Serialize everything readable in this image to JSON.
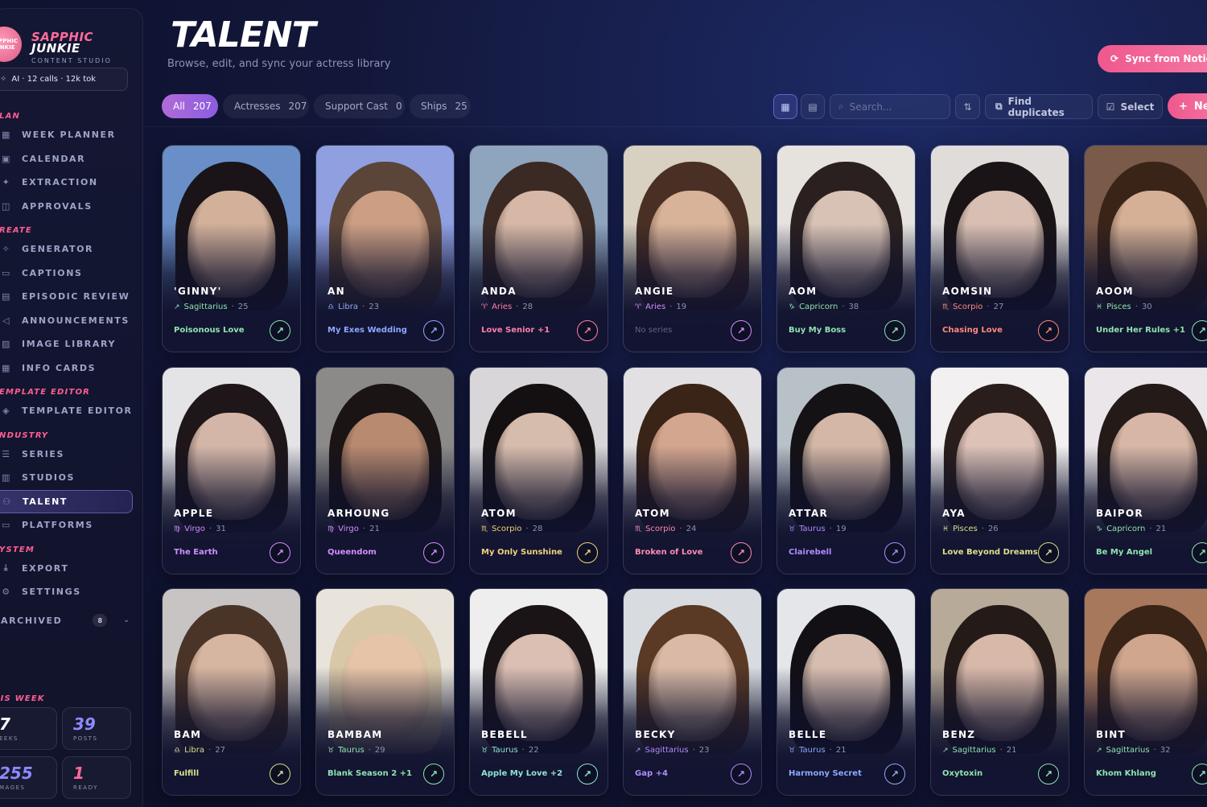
{
  "brand": {
    "logo_text": "SAPPHIC JUNKIE",
    "name_line1": "SAPPHIC",
    "name_line2": "JUNKIE",
    "subtitle": "CONTENT STUDIO",
    "ai_status": "AI · 12 calls · 12k tok"
  },
  "nav": {
    "sections": [
      {
        "title": "LAN",
        "items": [
          {
            "label": "WEEK PLANNER",
            "icon": "calendar-week-icon"
          },
          {
            "label": "CALENDAR",
            "icon": "calendar-icon"
          },
          {
            "label": "EXTRACTION",
            "icon": "magic-icon"
          },
          {
            "label": "APPROVALS",
            "icon": "inbox-icon"
          }
        ]
      },
      {
        "title": "REATE",
        "items": [
          {
            "label": "GENERATOR",
            "icon": "sparkle-icon"
          },
          {
            "label": "CAPTIONS",
            "icon": "caption-icon"
          },
          {
            "label": "EPISODIC REVIEW",
            "icon": "film-icon"
          },
          {
            "label": "ANNOUNCEMENTS",
            "icon": "megaphone-icon"
          },
          {
            "label": "IMAGE LIBRARY",
            "icon": "image-icon"
          },
          {
            "label": "INFO CARDS",
            "icon": "grid-icon"
          }
        ]
      },
      {
        "title": "EMPLATE EDITOR",
        "items": [
          {
            "label": "TEMPLATE EDITOR",
            "icon": "layers-icon"
          }
        ]
      },
      {
        "title": "NDUSTRY",
        "items": [
          {
            "label": "SERIES",
            "icon": "list-icon"
          },
          {
            "label": "STUDIOS",
            "icon": "building-icon"
          },
          {
            "label": "TALENT",
            "icon": "users-icon",
            "active": true
          },
          {
            "label": "PLATFORMS",
            "icon": "screen-icon"
          }
        ]
      },
      {
        "title": "YSTEM",
        "items": [
          {
            "label": "EXPORT",
            "icon": "download-icon"
          },
          {
            "label": "SETTINGS",
            "icon": "gear-icon"
          }
        ]
      }
    ],
    "archived": {
      "label": "ARCHIVED",
      "count": "8"
    }
  },
  "week": {
    "title": "HIS WEEK",
    "stats": [
      {
        "value": "7",
        "label": "EEKS",
        "color": "white"
      },
      {
        "value": "39",
        "label": "POSTS",
        "color": "purple"
      },
      {
        "value": "255",
        "label": "MAGES",
        "color": "purple"
      },
      {
        "value": "1",
        "label": "READY",
        "color": "pink"
      }
    ]
  },
  "header": {
    "title": "TALENT",
    "subtitle": "Browse, edit, and sync your actress library",
    "sync_label": "Sync from Notion"
  },
  "filters": [
    {
      "label": "All",
      "count": "207",
      "active": true
    },
    {
      "label": "Actresses",
      "count": "207"
    },
    {
      "label": "Support Cast",
      "count": "0"
    },
    {
      "label": "Ships",
      "count": "25"
    }
  ],
  "toolbar": {
    "search_placeholder": "Search...",
    "find_duplicates": "Find duplicates",
    "select": "Select",
    "new_label": "Ne"
  },
  "accent": {
    "pink": "#f0588d",
    "purple": "#8b5ce0"
  },
  "cards": [
    {
      "name": "'GINNY'",
      "sign": "Sagittarius",
      "sign_icon": "↗",
      "age": "25",
      "series": "Poisonous Love",
      "color": "#8fe3b0",
      "skin": "#e6c1a8",
      "hair": "#1a1418",
      "bg": "#6a8ec8"
    },
    {
      "name": "AN",
      "sign": "Libra",
      "sign_icon": "♎",
      "age": "23",
      "series": "My Exes Wedding",
      "color": "#8ea8ff",
      "skin": "#d9a98c",
      "hair": "#5a4538",
      "bg": "#8f9fe0"
    },
    {
      "name": "ANDA",
      "sign": "Aries",
      "sign_icon": "♈",
      "age": "28",
      "series": "Love Senior +1",
      "color": "#ff7fae",
      "skin": "#e8c7b4",
      "hair": "#3b2a24",
      "bg": "#8fa4bd"
    },
    {
      "name": "ANGIE",
      "sign": "Aries",
      "sign_icon": "♈",
      "age": "19",
      "series": "No series",
      "color": "#d48cff",
      "skin": "#e8c0a6",
      "hair": "#4a3024",
      "bg": "#d8d0c0",
      "none": true
    },
    {
      "name": "AOM",
      "sign": "Capricorn",
      "sign_icon": "♑",
      "age": "38",
      "series": "Buy My Boss",
      "color": "#8fe3b0",
      "skin": "#ecd4c6",
      "hair": "#2a2020",
      "bg": "#e6e2de"
    },
    {
      "name": "AOMSIN",
      "sign": "Scorpio",
      "sign_icon": "♏",
      "age": "27",
      "series": "Chasing Love",
      "color": "#ff8a7a",
      "skin": "#eed2c4",
      "hair": "#1a1416",
      "bg": "#e0dcda"
    },
    {
      "name": "AOOM",
      "sign": "Pisces",
      "sign_icon": "♓",
      "age": "30",
      "series": "Under Her Rules +1",
      "color": "#8fe3b0",
      "skin": "#e6c0a4",
      "hair": "#3a2418",
      "bg": "#7a5a48"
    },
    {
      "name": "APPLE",
      "sign": "Virgo",
      "sign_icon": "♍",
      "age": "31",
      "series": "The Earth",
      "color": "#d48cff",
      "skin": "#e8c8b8",
      "hair": "#1e1618",
      "bg": "#e4e4e6"
    },
    {
      "name": "ARHOUNG",
      "sign": "Virgo",
      "sign_icon": "♍",
      "age": "21",
      "series": "Queendom",
      "color": "#d48cff",
      "skin": "#c9977a",
      "hair": "#1a1414",
      "bg": "#8c8a88"
    },
    {
      "name": "ATOM",
      "sign": "Scorpio",
      "sign_icon": "♏",
      "age": "28",
      "series": "My Only Sunshine",
      "color": "#f0d27a",
      "skin": "#eccfbe",
      "hair": "#141012",
      "bg": "#d8d6d8"
    },
    {
      "name": "ATOM",
      "sign": "Scorpio",
      "sign_icon": "♏",
      "age": "24",
      "series": "Broken of Love",
      "color": "#ff8ab4",
      "skin": "#e4b49c",
      "hair": "#3a2418",
      "bg": "#e2e0e2"
    },
    {
      "name": "ATTAR",
      "sign": "Taurus",
      "sign_icon": "♉",
      "age": "19",
      "series": "Clairebell",
      "color": "#b08cff",
      "skin": "#e9c9b6",
      "hair": "#141214",
      "bg": "#b8c0c8"
    },
    {
      "name": "AYA",
      "sign": "Pisces",
      "sign_icon": "♓",
      "age": "26",
      "series": "Love Beyond Dreams",
      "color": "#d6e08a",
      "skin": "#f0d4c8",
      "hair": "#2a1e1c",
      "bg": "#f2f0f0"
    },
    {
      "name": "BAIPOR",
      "sign": "Capricorn",
      "sign_icon": "♑",
      "age": "21",
      "series": "Be My Angel",
      "color": "#8fe3b0",
      "skin": "#ecc8b6",
      "hair": "#241a18",
      "bg": "#eae6ea"
    },
    {
      "name": "BAM",
      "sign": "Libra",
      "sign_icon": "♎",
      "age": "27",
      "series": "Fulfill",
      "color": "#d6e08a",
      "skin": "#e6c4ae",
      "hair": "#4a3428",
      "bg": "#c8c4c4"
    },
    {
      "name": "BAMBAM",
      "sign": "Taurus",
      "sign_icon": "♉",
      "age": "29",
      "series": "Blank Season 2 +1",
      "color": "#8fe3b0",
      "skin": "#e8c4a8",
      "hair": "#d8c8a8",
      "bg": "#e8e4dc"
    },
    {
      "name": "BEBELL",
      "sign": "Taurus",
      "sign_icon": "♉",
      "age": "22",
      "series": "Apple My Love +2",
      "color": "#8fe3d0",
      "skin": "#f0d2c4",
      "hair": "#1a1416",
      "bg": "#eeeeee"
    },
    {
      "name": "BECKY",
      "sign": "Sagittarius",
      "sign_icon": "↗",
      "age": "23",
      "series": "Gap +4",
      "color": "#b08cff",
      "skin": "#e8c8b4",
      "hair": "#5a3a24",
      "bg": "#d8dce0"
    },
    {
      "name": "BELLE",
      "sign": "Taurus",
      "sign_icon": "♉",
      "age": "21",
      "series": "Harmony Secret",
      "color": "#8ea8ff",
      "skin": "#ecd0c0",
      "hair": "#121014",
      "bg": "#e4e6ea"
    },
    {
      "name": "BENZ",
      "sign": "Sagittarius",
      "sign_icon": "↗",
      "age": "21",
      "series": "Oxytoxin",
      "color": "#8fe3b0",
      "skin": "#eccab8",
      "hair": "#241a18",
      "bg": "#b8aa98"
    },
    {
      "name": "BINT",
      "sign": "Sagittarius",
      "sign_icon": "↗",
      "age": "32",
      "series": "Khom Khlang",
      "color": "#8fe3b0",
      "skin": "#e0b49a",
      "hair": "#3a2418",
      "bg": "#a8785c"
    }
  ]
}
